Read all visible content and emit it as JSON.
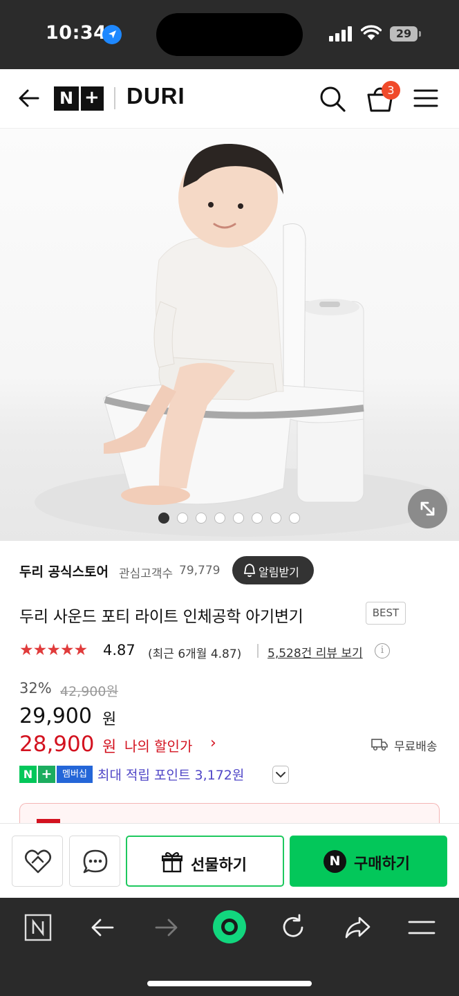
{
  "status_bar": {
    "time": "10:34",
    "battery": "29"
  },
  "header": {
    "brand_n": "N",
    "brand_plus": "+",
    "store_logo": "DURI",
    "cart_count": "3"
  },
  "hero": {
    "image_count": 8,
    "active_index": 0,
    "image_description_icon": "expand-icon"
  },
  "store": {
    "name": "두리 공식스토어",
    "followers_label": "관심고객수",
    "followers_count": "79,779",
    "alert_button": "알림받기"
  },
  "product": {
    "title": "두리 사운드 포티 라이트 인체공학 아기변기",
    "badge": "BEST",
    "stars": "★★★★★",
    "rating": "4.87",
    "rating_recent": "(최근 6개월 4.87)",
    "review_link": "5,528건 리뷰 보기",
    "discount_rate": "32%",
    "original_price": "42,900원",
    "price": "29,900",
    "price_unit": "원",
    "my_price": "28,900",
    "my_price_unit": "원",
    "my_price_label": "나의 할인가",
    "my_price_arrow": "›",
    "shipping": "무료배송",
    "membership_n": "N",
    "membership_plus": "+",
    "membership_label": "멤버십",
    "points_text": "최대 적립 포인트 3,172원"
  },
  "actions": {
    "gift": "선물하기",
    "buy_n": "N",
    "buy": "구매하기"
  },
  "colors": {
    "naver_green": "#03c75a",
    "sale_red": "#d3121f",
    "points_purple": "#5046c7",
    "cart_badge": "#f04a2a"
  }
}
